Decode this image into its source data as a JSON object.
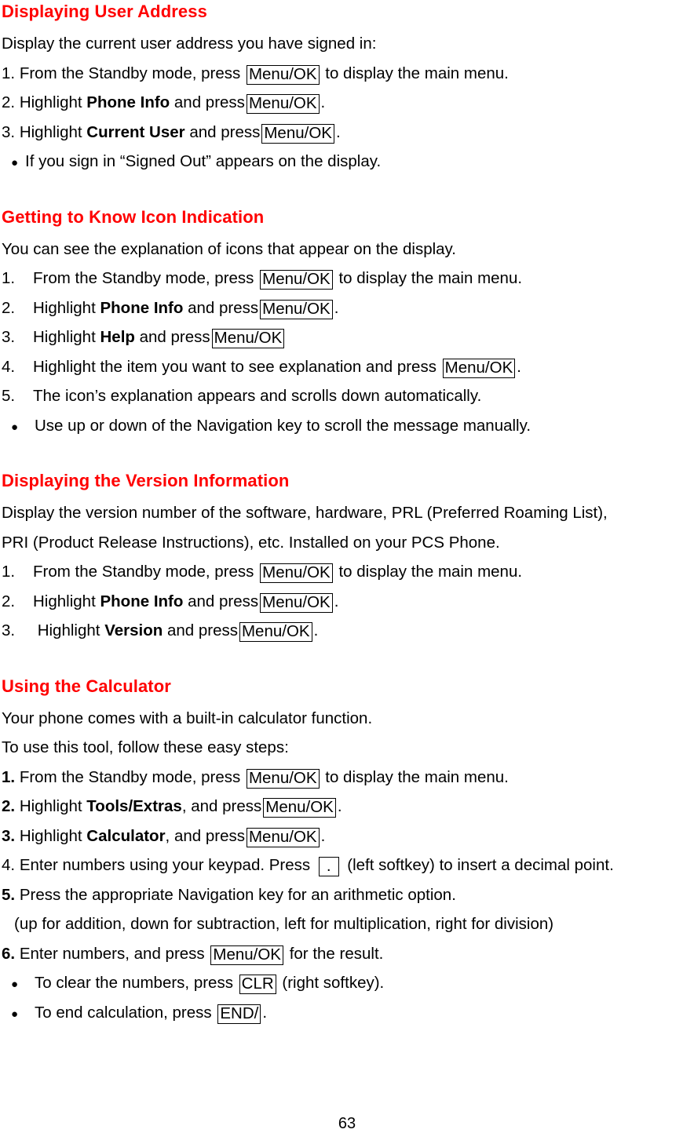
{
  "document": {
    "page_number": "63",
    "heading_color": "#ff0000",
    "body_color": "#000000"
  },
  "keys": {
    "menu_ok": "Menu/OK",
    "clr": "CLR",
    "end": "END/",
    "dot": "."
  },
  "sections": [
    {
      "id": "displaying-user-address",
      "heading": "Displaying User Address",
      "intro": "Display the current user address you have signed in:",
      "steps": [
        {
          "marker": "1.",
          "pre": "From the Standby mode, press",
          "bold": "",
          "mid": "",
          "key": "Menu/OK",
          "post": "to display the main menu."
        },
        {
          "marker": "2.",
          "pre": "Highlight",
          "bold": "Phone Info",
          "mid": "and press",
          "key": "Menu/OK",
          "post": "."
        },
        {
          "marker": "3.",
          "pre": "Highlight",
          "bold": "Current User",
          "mid": "and press",
          "key": "Menu/OK",
          "post": "."
        }
      ],
      "bullets": [
        "If you sign in “Signed Out” appears on the display."
      ]
    },
    {
      "id": "getting-to-know-icon-indication",
      "heading": "Getting to Know Icon Indication",
      "intro": "You can see the explanation of icons that appear on the display.",
      "steps": [
        {
          "marker": "1.",
          "pre": "From the Standby mode, press",
          "bold": "",
          "mid": "",
          "key": "Menu/OK",
          "post": "to display the main menu."
        },
        {
          "marker": "2.",
          "pre": "Highlight",
          "bold": "Phone Info",
          "mid": "and press",
          "key": "Menu/OK",
          "post": "."
        },
        {
          "marker": "3.",
          "pre": "Highlight",
          "bold": "Help",
          "mid": "and press",
          "key": "Menu/OK",
          "post": ""
        },
        {
          "marker": "4.",
          "pre": "Highlight the item you want to see explanation and press",
          "bold": "",
          "mid": "",
          "key": "Menu/OK",
          "post": "."
        },
        {
          "marker": "5.",
          "pre": "The icon’s explanation appears and scrolls down automatically.",
          "bold": "",
          "mid": "",
          "key": "",
          "post": ""
        }
      ],
      "bullets": [
        "Use up or down of the Navigation key to scroll the message manually."
      ]
    },
    {
      "id": "displaying-the-version-information",
      "heading": "Displaying the Version Information",
      "intro_line_1": "Display the version number of the software, hardware, PRL (Preferred Roaming List),",
      "intro_line_2": "PRI (Product Release Instructions), etc. Installed on your PCS Phone.",
      "steps": [
        {
          "marker": "1.",
          "pre": "From the Standby mode, press",
          "bold": "",
          "mid": "",
          "key": "Menu/OK",
          "post": "to display the main menu."
        },
        {
          "marker": "2.",
          "pre": "Highlight",
          "bold": "Phone Info",
          "mid": "and press",
          "key": "Menu/OK",
          "post": "."
        },
        {
          "marker": "3.",
          "pre": "Highlight",
          "bold": "Version",
          "mid": "and press",
          "key": "Menu/OK",
          "post": "."
        }
      ]
    },
    {
      "id": "using-the-calculator",
      "heading": "Using the Calculator",
      "intro_line_1": "Your phone comes with a built-in calculator function.",
      "intro_line_2": "To use this tool, follow these easy steps:",
      "steps": [
        {
          "marker": "1.",
          "pre": "From the Standby mode, press",
          "bold": "",
          "mid": "",
          "key": "Menu/OK",
          "post": "to display the main menu."
        },
        {
          "marker": "2.",
          "pre": "Highlight",
          "bold": "Tools/Extras",
          "mid": ", and press",
          "key": "Menu/OK",
          "post": "."
        },
        {
          "marker": "3.",
          "pre": "Highlight",
          "bold": "Calculator",
          "mid": ", and press",
          "key": "Menu/OK",
          "post": "."
        },
        {
          "marker": "4.",
          "pre": "Enter numbers using your keypad. Press",
          "bold": "",
          "mid": "",
          "key": ".",
          "post": "(left softkey) to insert a decimal point."
        },
        {
          "marker": "5.",
          "pre": "Press the appropriate Navigation key for an arithmetic option.",
          "bold": "",
          "mid": "",
          "key": "",
          "post": ""
        },
        {
          "marker": "6.",
          "pre": "Enter numbers, and press",
          "bold": "",
          "mid": "",
          "key": "Menu/OK",
          "post": "for the result."
        }
      ],
      "step5_note": "(up for addition, down for subtraction, left for multiplication, right for division)",
      "bullets": [
        {
          "pre": "To clear the numbers, press",
          "key": "CLR",
          "post": "(right softkey)."
        },
        {
          "pre": "To end calculation, press",
          "key": "END/",
          "post": "."
        }
      ]
    }
  ]
}
